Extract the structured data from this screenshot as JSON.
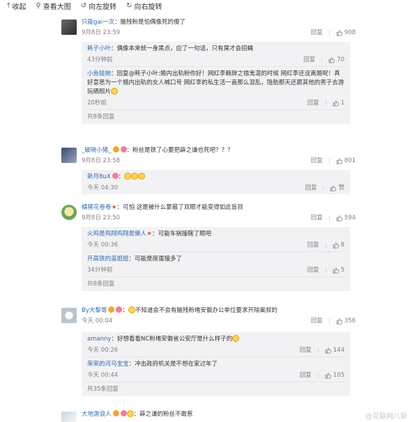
{
  "toolbar": {
    "collapse": "收起",
    "view_large": "查看大图",
    "rotate_left": "向左旋转",
    "rotate_right": "向右旋转"
  },
  "labels": {
    "reply": "回复"
  },
  "comments": [
    {
      "user": "只能gai一次",
      "text": "：脑残粉是怕偶像死的傻了",
      "time": "9月8日 23:59",
      "likes": "908",
      "replies": [
        {
          "user": "耗子小叶",
          "text": "：偶像本来就一身黑点，应了一句话，只有屎才会招蝇",
          "time": "43分钟前",
          "likes": "70"
        },
        {
          "user": "小鱼娃她",
          "text": "：回复@耗子小叶:婚内出轨粉你好！网红李赖辞之错鬼混的时候 网红李还没离婚呢！真好意思为一个婚内出轨的女人喊口号 网红李的私生活一直那么混乱，隐肋那天还跟其他的男子去游玩晒照片",
          "time": "20秒前",
          "likes": "1"
        }
      ],
      "more": "共8条回复"
    },
    {
      "user": "_破晓小猪_",
      "text": "：粉丝是铁了心要把薛之谦也死吧？？？",
      "time": "9月8日 23:58",
      "likes": "801",
      "replies": [
        {
          "user": "新月8uX",
          "text": "：",
          "time": "今天 04:30",
          "likes": "赞"
        }
      ]
    },
    {
      "user": "橘猪花卷卷",
      "text": "：可怕 这是被什么蒙蔽了双眼才能变得如此盲目",
      "time": "9月8日 23:50",
      "likes": "594",
      "replies": [
        {
          "user": "火鸡是鸡翔鸡翔是懒人",
          "text": "：可能车祸撞瞎了眼吧",
          "time": "今天 00:36",
          "likes": "8"
        },
        {
          "user": "开高铁的蛮姐姐",
          "text": "：可能是尿蛋撞多了",
          "time": "34分钟前",
          "likes": "5"
        }
      ],
      "more": "共8条回复"
    },
    {
      "user": "By大黎哥",
      "text": "不知道会不会有脑残粉堵安徽办公单位要求开除案叔的",
      "time": "今天 00:04",
      "likes": "356",
      "replies": [
        {
          "user": "amanny",
          "text": "：好想看看NC粉堵安徽省公安厅是什么样子的",
          "time": "今天 00:26",
          "likes": "144"
        },
        {
          "user": "荣荣的河马宝宝",
          "text": "：冲击政府机关是不想在家过年了",
          "time": "今天 00:44",
          "likes": "105"
        }
      ],
      "more": "共35条回复"
    },
    {
      "user": "大地游浪人",
      "text": "：薛之谦的粉丝不敢惹"
    }
  ],
  "watermark": "@互联网八卦"
}
